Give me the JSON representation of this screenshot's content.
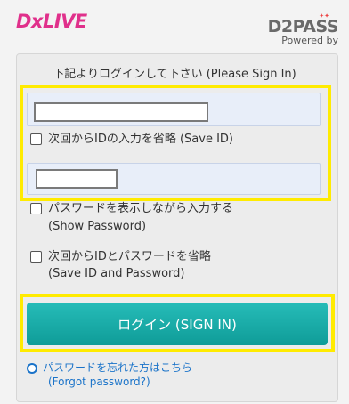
{
  "header": {
    "logo": "DxLIVE",
    "partner_name": "D2PASS",
    "partner_sub": "Powered by"
  },
  "form": {
    "title": "下記よりログインして下さい (Please Sign In)",
    "save_id": "次回からIDの入力を省略 (Save ID)",
    "show_password_1": "パスワードを表示しながら入力する",
    "show_password_2": "(Show Password)",
    "save_both_1": "次回からIDとパスワードを省略",
    "save_both_2": "(Save ID and Password)",
    "login_button": "ログイン (SIGN IN)",
    "forgot_1": "パスワードを忘れた方はこちら",
    "forgot_2": "(Forgot password?)"
  },
  "colors": {
    "logo": "#e0308b",
    "button": "#13a7a3",
    "link": "#1a73c9",
    "highlight": "#ffeb00"
  }
}
